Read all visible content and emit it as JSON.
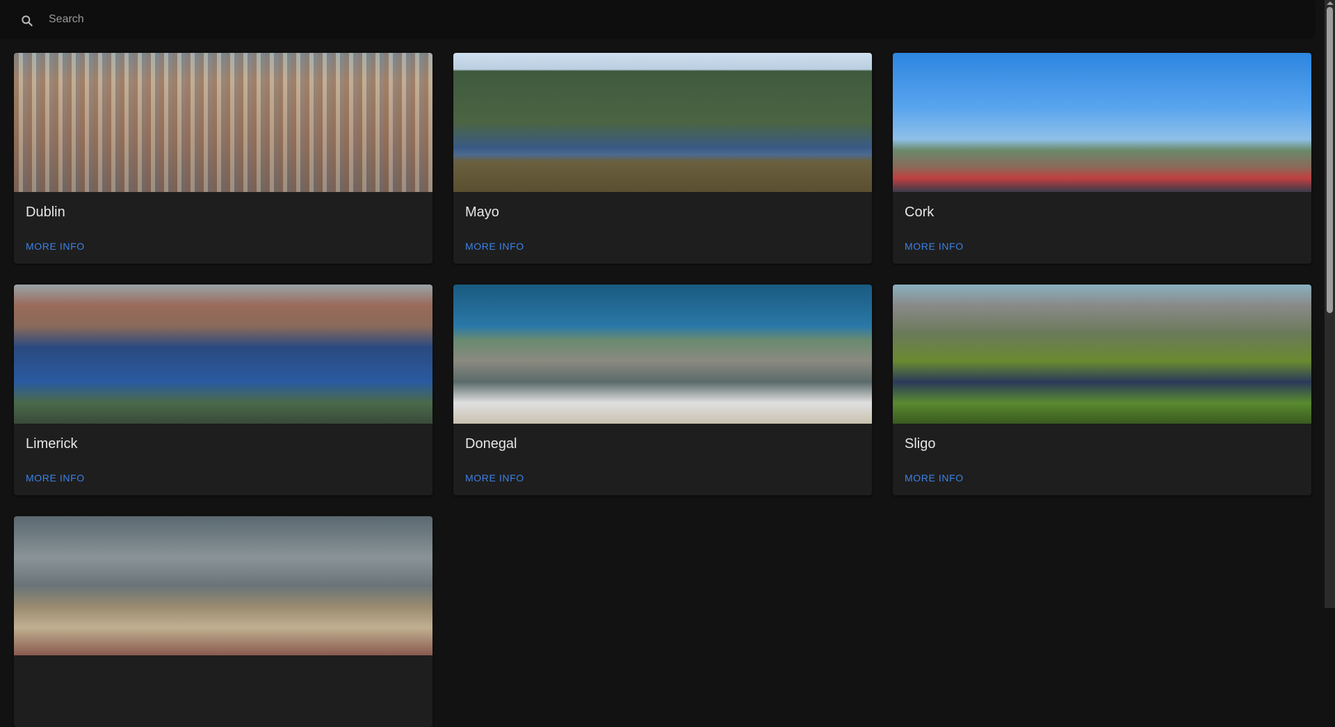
{
  "search": {
    "placeholder": "Search",
    "icon": "search-icon"
  },
  "accent_color": "#3d82e6",
  "cards": [
    {
      "title": "Dublin",
      "action": "MORE INFO"
    },
    {
      "title": "Mayo",
      "action": "MORE INFO"
    },
    {
      "title": "Cork",
      "action": "MORE INFO"
    },
    {
      "title": "Limerick",
      "action": "MORE INFO"
    },
    {
      "title": "Donegal",
      "action": "MORE INFO"
    },
    {
      "title": "Sligo",
      "action": "MORE INFO"
    },
    {
      "title": "",
      "action": ""
    }
  ]
}
